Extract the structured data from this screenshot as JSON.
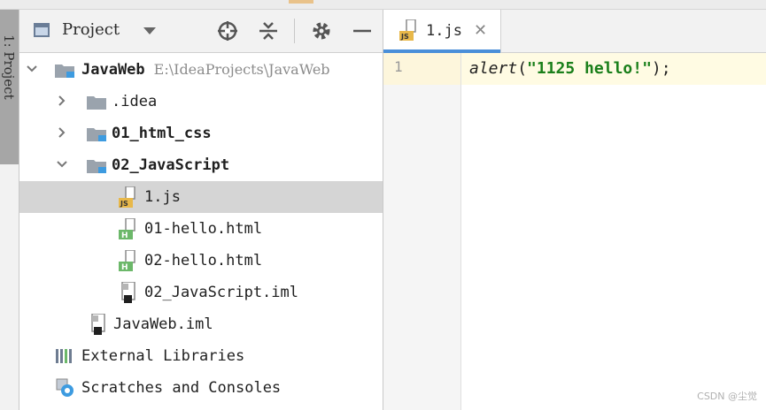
{
  "left_strip": {
    "tab_label": "1: Project"
  },
  "project_panel": {
    "title": "Project",
    "tree": [
      {
        "label": "JavaWeb",
        "path": "E:\\IdeaProjects\\JavaWeb",
        "type": "module",
        "expanded": true
      },
      {
        "label": ".idea",
        "type": "folder",
        "expanded": false
      },
      {
        "label": "01_html_css",
        "type": "folder",
        "expanded": false
      },
      {
        "label": "02_JavaScript",
        "type": "folder",
        "expanded": true
      },
      {
        "label": "1.js",
        "type": "js-file",
        "selected": true
      },
      {
        "label": "01-hello.html",
        "type": "html-file"
      },
      {
        "label": "02-hello.html",
        "type": "html-file"
      },
      {
        "label": "02_JavaScript.iml",
        "type": "iml-file"
      },
      {
        "label": "JavaWeb.iml",
        "type": "iml-file"
      },
      {
        "label": "External Libraries",
        "type": "libraries"
      },
      {
        "label": "Scratches and Consoles",
        "type": "scratches"
      }
    ]
  },
  "editor": {
    "tab": {
      "label": "1.js",
      "icon": "js-file-icon"
    },
    "line_number": "1",
    "code": {
      "fn": "alert",
      "open": "(",
      "string": "\"1125 hello!\"",
      "close": ");"
    }
  },
  "watermark": "CSDN @尘觉",
  "colors": {
    "selection": "#d5d5d5",
    "tab_underline": "#4a8fd9",
    "string_green": "#1a7f1a",
    "current_line": "#fffbe3",
    "folder_gray": "#9aa3ad",
    "module_blue": "#3d9be0"
  }
}
